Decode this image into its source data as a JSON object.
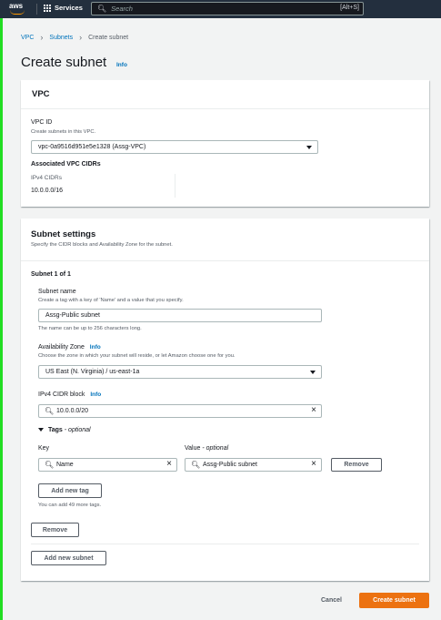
{
  "topnav": {
    "logo_text": "aws",
    "services_label": "Services",
    "search_placeholder": "Search",
    "search_shortcut": "[Alt+S]"
  },
  "breadcrumb": {
    "items": [
      "VPC",
      "Subnets",
      "Create subnet"
    ]
  },
  "page": {
    "title": "Create subnet",
    "info": "Info"
  },
  "vpc_panel": {
    "heading": "VPC",
    "vpc_id_label": "VPC ID",
    "vpc_id_desc": "Create subnets in this VPC.",
    "vpc_id_value": "vpc-0a9516d951e5e1328 (Assg-VPC)",
    "assoc_heading": "Associated VPC CIDRs",
    "ipv4_cidrs_label": "IPv4 CIDRs",
    "ipv4_cidrs_value": "10.0.0.0/16"
  },
  "subnet_settings": {
    "heading": "Subnet settings",
    "desc": "Specify the CIDR blocks and Availability Zone for the subnet.",
    "subnet_counter": "Subnet 1 of 1",
    "name_label": "Subnet name",
    "name_desc": "Create a tag with a key of 'Name' and a value that you specify.",
    "name_value": "Assg-Public subnet",
    "name_hint": "The name can be up to 256 characters long.",
    "az_label": "Availability Zone",
    "az_info": "Info",
    "az_desc": "Choose the zone in which your subnet will reside, or let Amazon choose one for you.",
    "az_value": "US East (N. Virginia) / us-east-1a",
    "cidr_label": "IPv4 CIDR block",
    "cidr_info": "Info",
    "cidr_value": "10.0.0.0/20",
    "tags_label": "Tags",
    "tags_optional": "- optional",
    "key_label": "Key",
    "value_label": "Value",
    "value_optional": "- optional",
    "tag_key": "Name",
    "tag_value": "Assg-Public subnet",
    "remove_tag_label": "Remove",
    "add_tag_label": "Add new tag",
    "tags_hint": "You can add 49 more tags.",
    "remove_subnet_label": "Remove",
    "add_subnet_label": "Add new subnet"
  },
  "footer": {
    "cancel_label": "Cancel",
    "create_label": "Create subnet"
  },
  "colors": {
    "nav_bg": "#232f3e",
    "link": "#0073bb",
    "primary": "#ec7211",
    "page_bg": "#f2f3f3"
  }
}
